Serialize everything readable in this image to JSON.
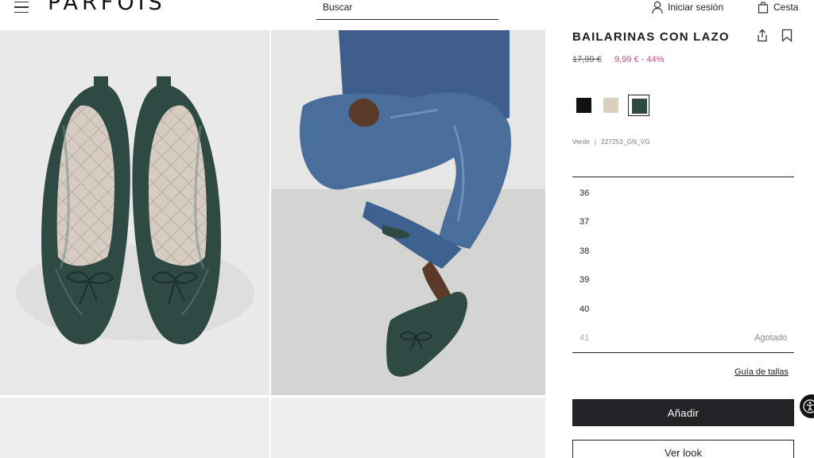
{
  "header": {
    "logo": "PARFOIS",
    "search_label": "Buscar",
    "login_label": "Iniciar sesión",
    "cart_label": "Cesta"
  },
  "product": {
    "title": "BAILARINAS CON LAZO",
    "old_price": "17,99 €",
    "new_price": "9,99 € - 44%",
    "color_name": "Verde",
    "reference": "227253_GN_VG",
    "swatches": [
      {
        "name": "Negro",
        "color": "#111111"
      },
      {
        "name": "Beige",
        "color": "#d8cfbd"
      },
      {
        "name": "Verde",
        "color": "#2f4a43",
        "selected": true
      }
    ]
  },
  "sizes": [
    {
      "label": "36",
      "status": ""
    },
    {
      "label": "37",
      "status": ""
    },
    {
      "label": "38",
      "status": ""
    },
    {
      "label": "39",
      "status": ""
    },
    {
      "label": "40",
      "status": ""
    },
    {
      "label": "41",
      "status": "Agotado"
    }
  ],
  "actions": {
    "size_guide": "Guía de tallas",
    "add": "Añadir",
    "see_look": "Ver look"
  },
  "colors": {
    "sale": "#c2477a",
    "primary_button": "#222324"
  }
}
